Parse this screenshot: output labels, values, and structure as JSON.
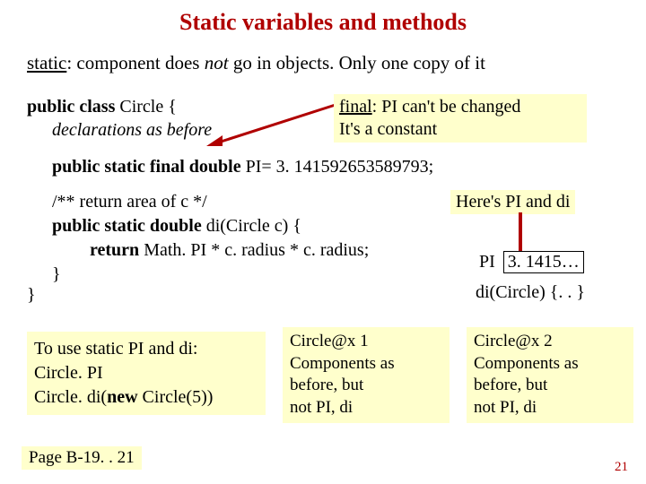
{
  "title": "Static variables and methods",
  "subtitle_parts": {
    "static_word": "static",
    "middle": ": component does ",
    "not_word": "not",
    "end": " go in objects. Only one copy of it"
  },
  "class_decl": {
    "prefix": "public class ",
    "name": "Circle {",
    "decls_before": "declarations as before"
  },
  "pi_line": {
    "prefix": "public static final double ",
    "rest": "PI= 3. 141592653589793;"
  },
  "method": {
    "comment": "/** return area of c */",
    "sig_prefix": "public static double ",
    "sig_rest": "di(Circle c) {",
    "ret_prefix": "return ",
    "ret_rest": "Math. PI * c. radius * c. radius;",
    "close": "}"
  },
  "close_brace": "}",
  "final_box": {
    "l1a": "final",
    "l1b": ": PI can't be changed",
    "l2": "It's  a constant"
  },
  "here_label": "Here's PI and di",
  "pi_val": {
    "label": "PI",
    "value": "3. 1415…"
  },
  "di_sig": "di(Circle) {. . }",
  "use_box": {
    "l1": "To use static  PI and di:",
    "l2": "Circle. PI",
    "l3a": "Circle. di(",
    "l3b": "new ",
    "l3c": "Circle(5))"
  },
  "obj1": {
    "name": "Circle@x 1",
    "l2": "Components as",
    "l3": "before, but",
    "l4": "not PI, di"
  },
  "obj2": {
    "name": "Circle@x 2",
    "l2": "Components as",
    "l3": "before, but",
    "l4": "not PI, di"
  },
  "page_ref": "Page B-19. . 21",
  "slide_num": "21"
}
